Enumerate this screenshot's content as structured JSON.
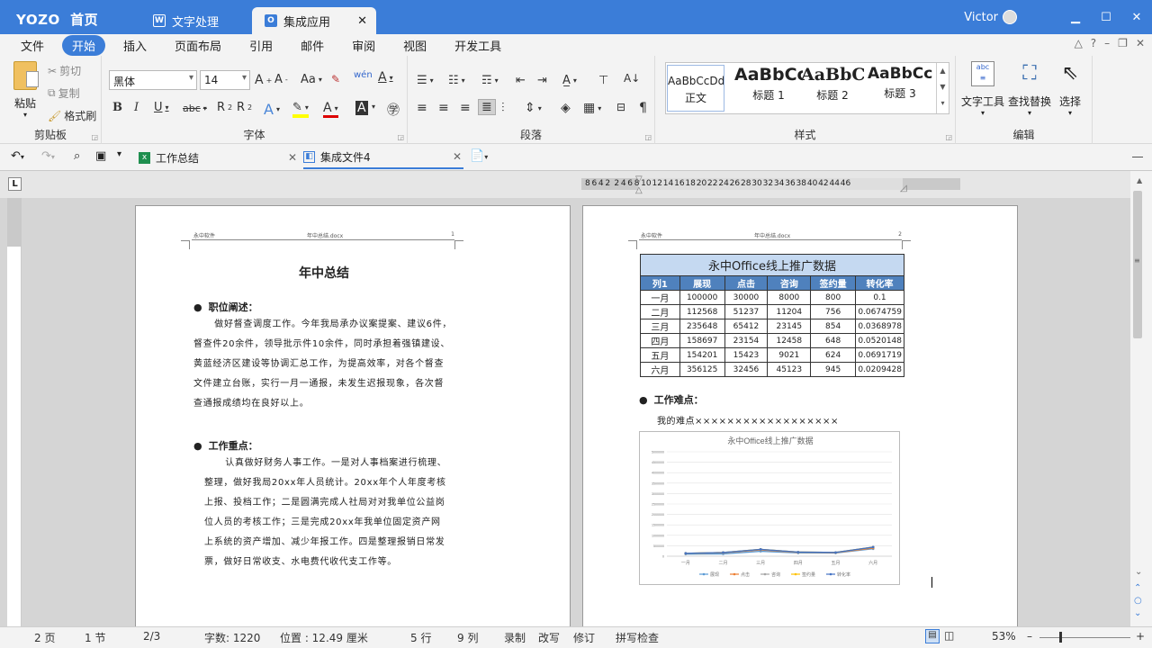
{
  "app": {
    "logo": "YOZO",
    "home_label": "首页",
    "tabs": [
      {
        "label": "文字处理",
        "icon": "W"
      },
      {
        "label": "集成应用",
        "icon": "O"
      }
    ],
    "user_name": "Victor"
  },
  "menu": [
    "文件",
    "开始",
    "插入",
    "页面布局",
    "引用",
    "邮件",
    "审阅",
    "视图",
    "开发工具"
  ],
  "ribbon": {
    "clipboard": {
      "paste": "粘贴",
      "cut": "剪切",
      "copy": "复制",
      "format_painter": "格式刷",
      "label": "剪贴板"
    },
    "font": {
      "name": "黑体",
      "size": "14",
      "label": "字体"
    },
    "paragraph": {
      "label": "段落"
    },
    "styles": {
      "items": [
        {
          "preview": "AaBbCcDd",
          "name": "正文"
        },
        {
          "preview": "AaBbCc",
          "name": "标题 1"
        },
        {
          "preview": "AaBbC",
          "name": "标题 2"
        },
        {
          "preview": "AaBbCcD",
          "name": "标题 3"
        }
      ],
      "label": "样式"
    },
    "edit": {
      "text_tools": "文字工具",
      "find_replace": "查找替换",
      "select": "选择",
      "label": "编辑"
    }
  },
  "files": [
    {
      "name": "工作总结",
      "icon": "excel"
    },
    {
      "name": "集成文件4",
      "icon": "integrated"
    }
  ],
  "ruler_numbers": "8  6  4  2     2  4  6  8  10 12 14 16 18 20 22 24 26 28 30 32 34 36 38 40 42 44 46",
  "page1": {
    "header_left": "永中软件",
    "header_mid": "年中总结.docx",
    "header_num": "1",
    "title": "年中总结",
    "section1": "职位阐述：",
    "para1_lines": [
      "      做好督查调度工作。今年我局承办议案提案、建议6件，",
      "督查件20余件，领导批示件10余件，同时承担着强镇建设、",
      "黄蓝经济区建设等协调汇总工作，为提高效率，对各个督查",
      "文件建立台账，实行一月一通报，未发生迟报现象，各次督",
      "查通报成绩均在良好以上。"
    ],
    "section2": "工作重点：",
    "para2_lines": [
      "      认真做好财务人事工作。一是对人事档案进行梳理、",
      "整理，做好我局20xx年人员统计。20xx年个人年度考核",
      "上报、投档工作；二是圆满完成人社局对对我单位公益岗",
      "位人员的考核工作；三是完成20xx年我单位固定资产网",
      "上系统的资产增加、减少年报工作。四是整理报销日常发",
      "票，做好日常收支、水电费代收代支工作等。"
    ]
  },
  "page2": {
    "header_left": "永中软件",
    "header_mid": "年中总结.docx",
    "header_num": "2",
    "table": {
      "title": "永中Office线上推广数据",
      "headers": [
        "列1",
        "展现",
        "点击",
        "咨询",
        "签约量",
        "转化率"
      ],
      "rows": [
        [
          "一月",
          "100000",
          "30000",
          "8000",
          "800",
          "0.1"
        ],
        [
          "二月",
          "112568",
          "51237",
          "11204",
          "756",
          "0.0674759"
        ],
        [
          "三月",
          "235648",
          "65412",
          "23145",
          "854",
          "0.0368978"
        ],
        [
          "四月",
          "158697",
          "23154",
          "12458",
          "648",
          "0.0520148"
        ],
        [
          "五月",
          "154201",
          "15423",
          "9021",
          "624",
          "0.0691719"
        ],
        [
          "六月",
          "356125",
          "32456",
          "45123",
          "945",
          "0.0209428"
        ]
      ]
    },
    "section": "工作难点：",
    "difficulty": "我的难点××××××××××××××××××"
  },
  "chart_data": {
    "type": "line",
    "title": "永中Office线上推广数据",
    "categories": [
      "一月",
      "二月",
      "三月",
      "四月",
      "五月",
      "六月"
    ],
    "ylim": [
      0,
      5000000
    ],
    "yticks": [
      "5000000",
      "4500000",
      "4000000",
      "3500000",
      "3000000",
      "2500000",
      "2000000",
      "1500000",
      "1000000",
      "500000",
      "0"
    ],
    "stacked": true,
    "legend_position": "bottom",
    "series": [
      {
        "name": "展现",
        "color": "#5b9bd5",
        "values": [
          100000,
          112568,
          235648,
          158697,
          154201,
          356125
        ]
      },
      {
        "name": "点击",
        "color": "#ed7d31",
        "values": [
          30000,
          51237,
          65412,
          23154,
          15423,
          32456
        ]
      },
      {
        "name": "咨询",
        "color": "#a5a5a5",
        "values": [
          8000,
          11204,
          23145,
          12458,
          9021,
          45123
        ]
      },
      {
        "name": "签约量",
        "color": "#ffc000",
        "values": [
          800,
          756,
          854,
          648,
          624,
          945
        ]
      },
      {
        "name": "转化率",
        "color": "#4472c4",
        "values": [
          0.1,
          0.0674759,
          0.0368978,
          0.0520148,
          0.0691719,
          0.0209428
        ]
      }
    ]
  },
  "status": {
    "page": "2 页",
    "section": "1 节",
    "pages": "2/3",
    "words": "字数: 1220",
    "position": "位置 : 12.49 厘米",
    "line": "5 行",
    "column": "9 列",
    "record": "录制",
    "overwrite": "改写",
    "revise": "修订",
    "spell": "拼写检查",
    "zoom": "53%"
  }
}
